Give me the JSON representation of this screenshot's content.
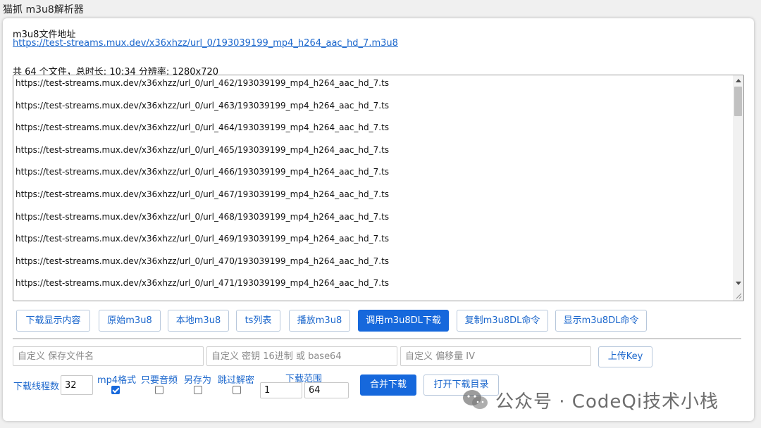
{
  "app": {
    "title": "猫抓 m3u8解析器"
  },
  "source": {
    "label": "m3u8文件地址",
    "url": "https://test-streams.mux.dev/x36xhzz/url_0/193039199_mp4_h264_aac_hd_7.m3u8"
  },
  "summary": "共 64 个文件，总时长: 10:34 分辨率: 1280x720",
  "ts_list": [
    "https://test-streams.mux.dev/x36xhzz/url_0/url_462/193039199_mp4_h264_aac_hd_7.ts",
    "https://test-streams.mux.dev/x36xhzz/url_0/url_463/193039199_mp4_h264_aac_hd_7.ts",
    "https://test-streams.mux.dev/x36xhzz/url_0/url_464/193039199_mp4_h264_aac_hd_7.ts",
    "https://test-streams.mux.dev/x36xhzz/url_0/url_465/193039199_mp4_h264_aac_hd_7.ts",
    "https://test-streams.mux.dev/x36xhzz/url_0/url_466/193039199_mp4_h264_aac_hd_7.ts",
    "https://test-streams.mux.dev/x36xhzz/url_0/url_467/193039199_mp4_h264_aac_hd_7.ts",
    "https://test-streams.mux.dev/x36xhzz/url_0/url_468/193039199_mp4_h264_aac_hd_7.ts",
    "https://test-streams.mux.dev/x36xhzz/url_0/url_469/193039199_mp4_h264_aac_hd_7.ts",
    "https://test-streams.mux.dev/x36xhzz/url_0/url_470/193039199_mp4_h264_aac_hd_7.ts",
    "https://test-streams.mux.dev/x36xhzz/url_0/url_471/193039199_mp4_h264_aac_hd_7.ts"
  ],
  "buttons": {
    "download_shown": "下载显示内容",
    "original_m3u8": "原始m3u8",
    "local_m3u8": "本地m3u8",
    "ts_list": "ts列表",
    "play_m3u8": "播放m3u8",
    "call_m3u8dl": "调用m3u8DL下载",
    "copy_m3u8dl_cmd": "复制m3u8DL命令",
    "show_m3u8dl_cmd": "显示m3u8DL命令",
    "upload_key": "上传Key",
    "merge_download": "合并下载",
    "open_download_dir": "打开下载目录"
  },
  "inputs": {
    "filename_placeholder": "自定义 保存文件名",
    "key_placeholder": "自定义 密钥 16进制 或 base64",
    "iv_placeholder": "自定义 偏移量 IV"
  },
  "options": {
    "threads_label": "下载线程数",
    "threads_value": "32",
    "mp4_label": "mp4格式",
    "mp4_checked": true,
    "audio_only_label": "只要音频",
    "audio_only_checked": false,
    "save_as_label": "另存为",
    "save_as_checked": false,
    "skip_decrypt_label": "跳过解密",
    "skip_decrypt_checked": false,
    "range_label": "下载范围",
    "range_start": "1",
    "range_end": "64"
  },
  "watermark": "公众号 · CodeQi技术小栈",
  "colors": {
    "accent": "#1668dc",
    "link": "#1a66cc"
  }
}
